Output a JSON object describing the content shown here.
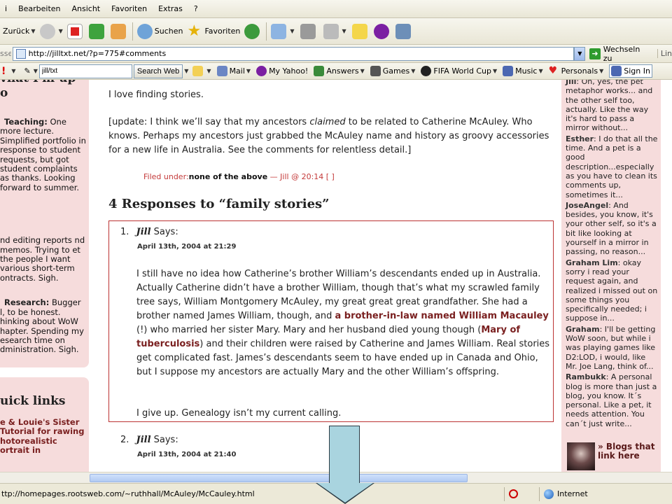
{
  "menu": [
    "i",
    "Bearbeiten",
    "Ansicht",
    "Favoriten",
    "Extras",
    "?"
  ],
  "toolbar": {
    "back_label": "Zurück",
    "search_label": "Suchen",
    "favorites_label": "Favoriten"
  },
  "address": {
    "side_label": "sse",
    "url": "http://jilltxt.net/?p=775#comments",
    "go_label": "Wechseln zu",
    "links_label": "Lin"
  },
  "linksbar": {
    "search_value": "jill/txt",
    "search_button": "Search Web",
    "items": [
      "Mail",
      "My Yahoo!",
      "Answers",
      "Games",
      "FIFA World Cup",
      "Music",
      "Personals",
      "Sign In"
    ]
  },
  "left": {
    "title": "vhat I'm up\no",
    "teaching_label": "Teaching:",
    "teaching_text": " One more lecture. Simplified portfolio in response to student requests, but got student complaints as thanks. Looking forward to summer.",
    "editing_text": "nd editing reports nd memos. Trying to et the people I want various short-term ontracts. Sigh.",
    "research_label": "Research:",
    "research_text": " Bugger l, to be honest. hinking about WoW hapter. Spending my esearch time on dministration. Sigh.",
    "quick_links": "uick links",
    "quick_link_item": "e & Louie's Sister Tutorial for rawing hotorealistic ortrait in"
  },
  "post": {
    "intro": "I love finding stories.",
    "update_before": "[update: I think we’ll say that my ancestors ",
    "update_em": "claimed",
    "update_after": " to be related to Catherine McAuley. Who knows. Perhaps my ancestors just grabbed the McAuley name and history as groovy accessories for a new life in Australia. See the comments for relentless detail.]",
    "filed_label": "Filed under:",
    "filed_category": "none of the above",
    "filed_meta": " — Jill @ 20:14 [ ]",
    "responses_heading": "4 Responses to “family stories”"
  },
  "comments": [
    {
      "num": "1.",
      "author": "Jill",
      "says": " Says:",
      "date": "April 13th, 2004 at 21:29",
      "p1_a": "I still have no idea how Catherine’s brother William’s descendants ended up in Australia. Actually Catherine didn’t have a brother William, though that’s what my scrawled family tree says, William Montgomery McAuley, my great great great grandfather. She had a brother named James William, though, and ",
      "p1_link1": "a brother-in-law named William Macauley",
      "p1_b": " (!) who married her sister Mary. Mary and her husband died young though (",
      "p1_link2": "Mary of tuberculosis",
      "p1_c": ") and their children were raised by Catherine and James William. Real stories get complicated fast. James’s descendants seem to have ended up in Canada and Ohio, but I suppose my ancestors are actually Mary and the other William’s offspring.",
      "p2": "I give up. Genealogy isn’t my current calling."
    },
    {
      "num": "2.",
      "author": "Jill",
      "says": " Says:",
      "date": "April 13th, 2004 at 21:40"
    }
  ],
  "recent_comments": [
    {
      "author": "Jill",
      "text": ": Oh, yes, the pet metaphor works... and the other self too, actually. Like the way it's hard to pass a mirror without..."
    },
    {
      "author": "Esther",
      "text": ": I do that all the time. And a pet is a good description...especially as you have to clean its comments up, sometimes it..."
    },
    {
      "author": "JoseAngel",
      "text": ": And besides, you know, it's your other self, so it's a bit like looking at yourself in a mirror in passing, no reason..."
    },
    {
      "author": "Graham Lim",
      "text": ": okay sorry i read your request again, and realized i missed out on some things you specifically needed; i suppose in..."
    },
    {
      "author": "Graham",
      "text": ": I'll be getting WoW soon, but while i was playing games like D2:LOD, i would, like Mr. Joe Lang, think of..."
    },
    {
      "author": "Rambukk",
      "text": ": A personal blog is more than just a blog, you know. It´s personal. Like a pet, it needs attention. You can´t just write..."
    }
  ],
  "blogs_link": "» Blogs that link here",
  "status": {
    "url": "ttp://homepages.rootsweb.com/~ruthhall/McAuley/McCauley.html",
    "zone": "Internet"
  },
  "colors": {
    "sidebar_pink": "#f6dcdc",
    "comment_border": "#bb3333",
    "link_dark_red": "#7a2020",
    "annotation_arrow": "#a9d4df"
  }
}
